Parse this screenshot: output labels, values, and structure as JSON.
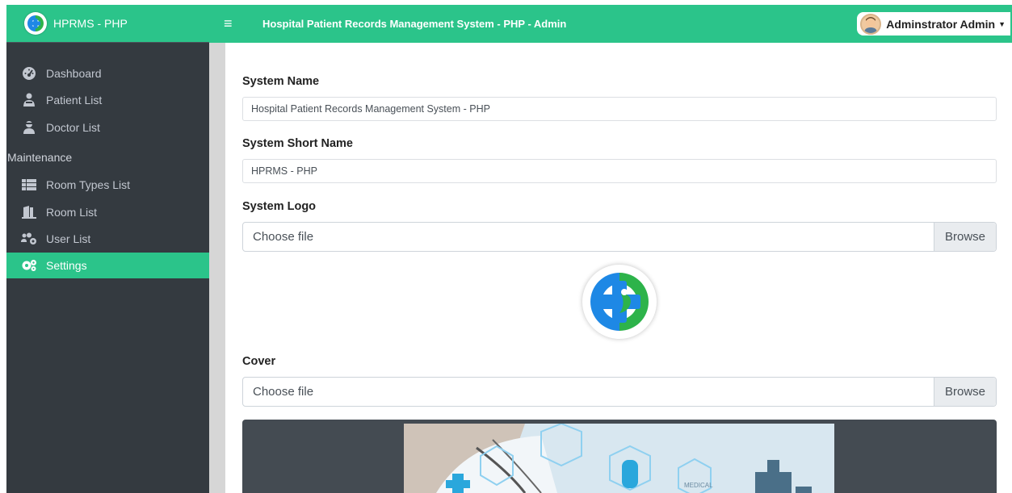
{
  "brand": {
    "name": "HPRMS - PHP",
    "color": "#2bc48a"
  },
  "topbar": {
    "menu_icon": "hamburger-icon",
    "title": "Hospital Patient Records Management System - PHP - Admin",
    "user_name": "Adminstrator Admin"
  },
  "sidebar": {
    "items": [
      {
        "label": "Dashboard",
        "icon": "tachometer-icon"
      },
      {
        "label": "Patient List",
        "icon": "patient-icon"
      },
      {
        "label": "Doctor List",
        "icon": "doctor-icon"
      }
    ],
    "section_header": "Maintenance",
    "maintenance_items": [
      {
        "label": "Room Types List",
        "icon": "list-icon"
      },
      {
        "label": "Room List",
        "icon": "door-icon"
      },
      {
        "label": "User List",
        "icon": "users-cog-icon"
      },
      {
        "label": "Settings",
        "icon": "cogs-icon",
        "active": true
      }
    ]
  },
  "form": {
    "system_name_label": "System Name",
    "system_name_value": "Hospital Patient Records Management System - PHP",
    "short_name_label": "System Short Name",
    "short_name_value": "HPRMS - PHP",
    "logo_label": "System Logo",
    "logo_file_placeholder": "Choose file",
    "logo_browse": "Browse",
    "cover_label": "Cover",
    "cover_file_placeholder": "Choose file",
    "cover_browse": "Browse",
    "cover_image_text": "MEDICAL"
  },
  "colors": {
    "sidebar_bg": "#343a40",
    "accent": "#2bc48a",
    "nav_text": "#c2c7d0"
  }
}
